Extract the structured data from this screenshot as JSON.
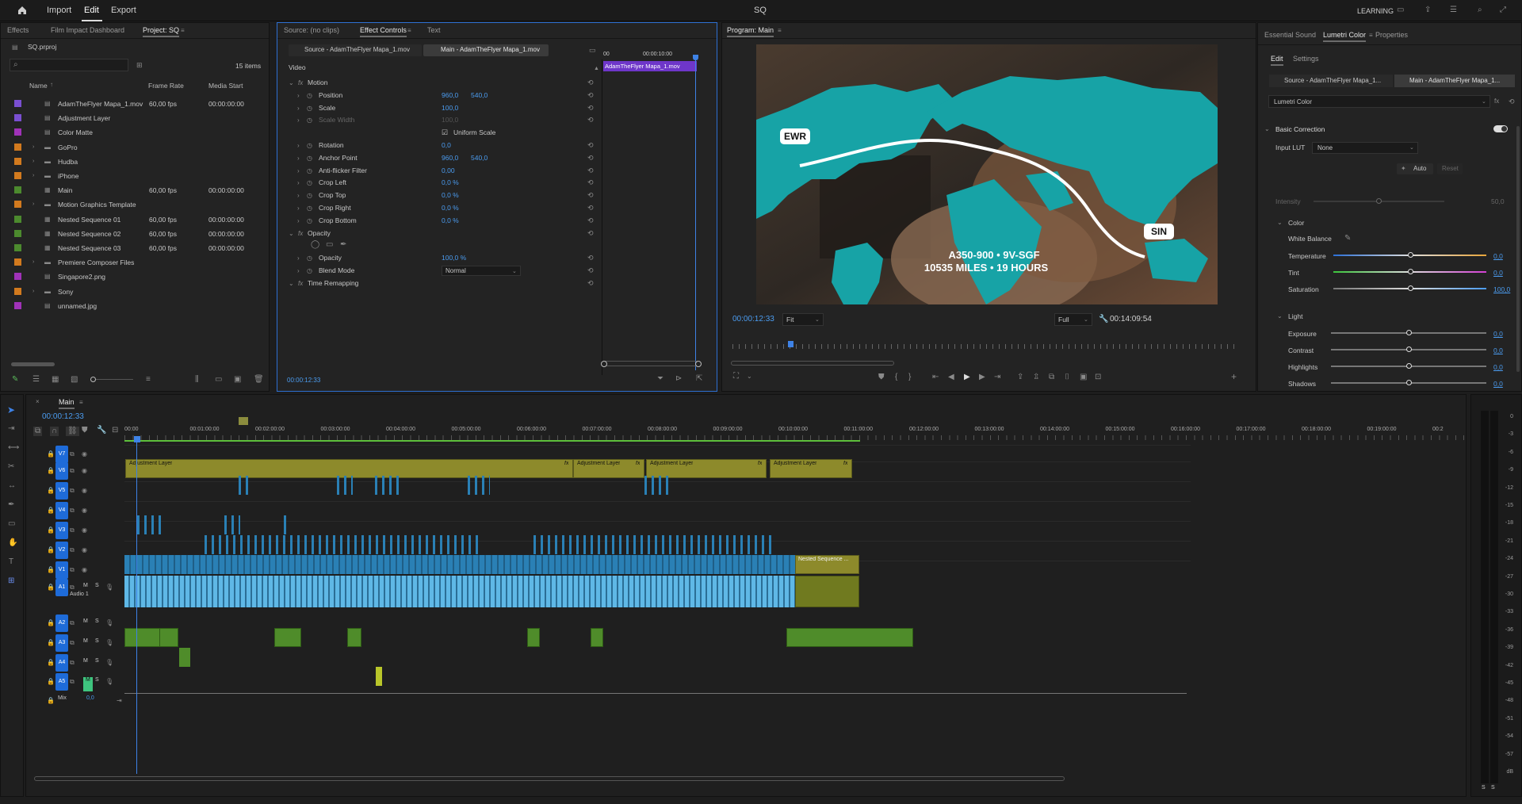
{
  "app": {
    "title": "SQ",
    "menu": [
      "Import",
      "Edit",
      "Export"
    ],
    "active_menu": "Edit",
    "workspace": "LEARNING"
  },
  "project_panel": {
    "tabs": [
      "Effects",
      "Film Impact Dashboard",
      "Project: SQ"
    ],
    "active_tab": "Project: SQ",
    "file": "SQ.prproj",
    "item_count": "15 items",
    "columns": [
      "Name",
      "Frame Rate",
      "Media Start"
    ],
    "items": [
      {
        "name": "AdamTheFlyer Mapa_1.mov",
        "color": "#7a4fd1",
        "fps": "60,00 fps",
        "start": "00:00:00:00",
        "type": "clip"
      },
      {
        "name": "Adjustment Layer",
        "color": "#7a4fd1",
        "fps": "",
        "start": "",
        "type": "clip"
      },
      {
        "name": "Color Matte",
        "color": "#a032b8",
        "fps": "",
        "start": "",
        "type": "clip"
      },
      {
        "name": "GoPro",
        "color": "#d27a1e",
        "fps": "",
        "start": "",
        "type": "folder"
      },
      {
        "name": "Hudba",
        "color": "#d27a1e",
        "fps": "",
        "start": "",
        "type": "folder"
      },
      {
        "name": "iPhone",
        "color": "#d27a1e",
        "fps": "",
        "start": "",
        "type": "folder"
      },
      {
        "name": "Main",
        "color": "#4c8a2e",
        "fps": "60,00 fps",
        "start": "00:00:00:00",
        "type": "sequence"
      },
      {
        "name": "Motion Graphics Template",
        "color": "#d27a1e",
        "fps": "",
        "start": "",
        "type": "folder"
      },
      {
        "name": "Nested Sequence 01",
        "color": "#4c8a2e",
        "fps": "60,00 fps",
        "start": "00:00:00:00",
        "type": "sequence"
      },
      {
        "name": "Nested Sequence 02",
        "color": "#4c8a2e",
        "fps": "60,00 fps",
        "start": "00:00:00:00",
        "type": "sequence"
      },
      {
        "name": "Nested Sequence 03",
        "color": "#4c8a2e",
        "fps": "60,00 fps",
        "start": "00:00:00:00",
        "type": "sequence"
      },
      {
        "name": "Premiere Composer Files",
        "color": "#d27a1e",
        "fps": "",
        "start": "",
        "type": "folder"
      },
      {
        "name": "Singapore2.png",
        "color": "#a032b8",
        "fps": "",
        "start": "",
        "type": "clip"
      },
      {
        "name": "Sony",
        "color": "#d27a1e",
        "fps": "",
        "start": "",
        "type": "folder"
      },
      {
        "name": "unnamed.jpg",
        "color": "#a032b8",
        "fps": "",
        "start": "",
        "type": "clip"
      }
    ]
  },
  "effect_controls": {
    "tabs": [
      "Source: (no clips)",
      "Effect Controls",
      "Text"
    ],
    "active_tab": "Effect Controls",
    "source_btn": "Source - AdamTheFlyer Mapa_1.mov",
    "main_btn": "Main - AdamTheFlyer Mapa_1.mov",
    "ruler_start": "00",
    "ruler_mid": "00:00:10:00",
    "clip_name": "AdamTheFlyer Mapa_1.mov",
    "section": "Video",
    "rows": [
      {
        "label": "Motion",
        "v1": "",
        "v2": "",
        "fx": true,
        "indent": 0
      },
      {
        "label": "Position",
        "v1": "960,0",
        "v2": "540,0",
        "indent": 1
      },
      {
        "label": "Scale",
        "v1": "100,0",
        "v2": "",
        "indent": 1
      },
      {
        "label": "Scale Width",
        "v1": "100,0",
        "v2": "",
        "indent": 1,
        "dim": true
      },
      {
        "label": "Uniform Scale",
        "v1": "",
        "v2": "",
        "indent": 2,
        "check": true
      },
      {
        "label": "Rotation",
        "v1": "0,0",
        "v2": "",
        "indent": 1
      },
      {
        "label": "Anchor Point",
        "v1": "960,0",
        "v2": "540,0",
        "indent": 1
      },
      {
        "label": "Anti-flicker Filter",
        "v1": "0,00",
        "v2": "",
        "indent": 1
      },
      {
        "label": "Crop Left",
        "v1": "0,0 %",
        "v2": "",
        "indent": 1
      },
      {
        "label": "Crop Top",
        "v1": "0,0 %",
        "v2": "",
        "indent": 1
      },
      {
        "label": "Crop Right",
        "v1": "0,0 %",
        "v2": "",
        "indent": 1
      },
      {
        "label": "Crop Bottom",
        "v1": "0,0 %",
        "v2": "",
        "indent": 1
      },
      {
        "label": "Opacity",
        "v1": "",
        "v2": "",
        "fx": true,
        "indent": 0
      },
      {
        "label": "",
        "v1": "",
        "v2": "",
        "indent": 1,
        "shapes": true
      },
      {
        "label": "Opacity",
        "v1": "100,0 %",
        "v2": "",
        "indent": 1
      },
      {
        "label": "Blend Mode",
        "v1": "Normal",
        "v2": "",
        "indent": 1,
        "select": true
      },
      {
        "label": "Time Remapping",
        "v1": "",
        "v2": "",
        "fx": true,
        "indent": 0
      }
    ],
    "timecode": "00:00:12:33"
  },
  "program": {
    "title": "Program: Main",
    "timecode": "00:00:12:33",
    "fit": "Fit",
    "quality": "Full",
    "duration": "00:14:09:54",
    "labels": {
      "ewr": "EWR",
      "sin": "SIN",
      "line1": "A350-900 • 9V-SGF",
      "line2": "10535 MILES • 19 HOURS"
    }
  },
  "lumetri": {
    "tabs": [
      "Essential Sound",
      "Lumetri Color",
      "Properties"
    ],
    "active_tab": "Lumetri Color",
    "subtabs": [
      "Edit",
      "Settings"
    ],
    "source_btn": "Source - AdamTheFlyer Mapa_1...",
    "main_btn": "Main - AdamTheFlyer Mapa_1...",
    "effect": "Lumetri Color",
    "basic": "Basic Correction",
    "input_lut_label": "Input LUT",
    "input_lut": "None",
    "auto": "Auto",
    "reset": "Reset",
    "intensity_label": "Intensity",
    "intensity": "50,0",
    "color_section": "Color",
    "white_balance": "White Balance",
    "sliders": [
      {
        "label": "Temperature",
        "value": "0,0",
        "level": 0.5,
        "track": "temp"
      },
      {
        "label": "Tint",
        "value": "0,0",
        "level": 0.5,
        "track": "tint"
      },
      {
        "label": "Saturation",
        "value": "100,0",
        "level": 0.5,
        "track": "sat"
      }
    ],
    "light_section": "Light",
    "light": [
      {
        "label": "Exposure",
        "value": "0,0",
        "level": 0.5
      },
      {
        "label": "Contrast",
        "value": "0,0",
        "level": 0.5
      },
      {
        "label": "Highlights",
        "value": "0,0",
        "level": 0.5
      },
      {
        "label": "Shadows",
        "value": "0,0",
        "level": 0.5
      }
    ]
  },
  "timeline": {
    "sequence": "Main",
    "timecode": "00:00:12:33",
    "ruler": [
      "00:00",
      "00:01:00:00",
      "00:02:00:00",
      "00:03:00:00",
      "00:04:00:00",
      "00:05:00:00",
      "00:06:00:00",
      "00:07:00:00",
      "00:08:00:00",
      "00:09:00:00",
      "00:10:00:00",
      "00:11:00:00",
      "00:12:00:00",
      "00:13:00:00",
      "00:14:00:00",
      "00:15:00:00",
      "00:16:00:00",
      "00:17:00:00",
      "00:18:00:00",
      "00:19:00:00",
      "00:2"
    ],
    "video_tracks": [
      "V7",
      "V6",
      "V5",
      "V4",
      "V3",
      "V2",
      "V1"
    ],
    "audio_tracks": [
      "A1",
      "A2",
      "A3",
      "A4",
      "A5"
    ],
    "audio_1_name": "Audio 1",
    "mix_label": "Mix",
    "mix_value": "0,0",
    "adjustment_label": "Adjustment Layer",
    "nested_label": "Nested Sequence ...",
    "m_label": "M",
    "s_label": "S"
  },
  "meter": {
    "scale": [
      "0",
      "-3",
      "-6",
      "-9",
      "-12",
      "-15",
      "-18",
      "-21",
      "-24",
      "-27",
      "-30",
      "-33",
      "-36",
      "-39",
      "-42",
      "-45",
      "-48",
      "-51",
      "-54",
      "-57",
      "dB"
    ],
    "bottom": [
      "S",
      "S"
    ]
  }
}
